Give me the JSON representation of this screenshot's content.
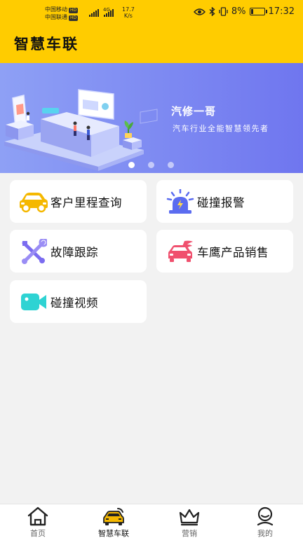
{
  "status_bar": {
    "carrier1": "中国移动",
    "carrier2": "中国联通",
    "hd": "HD",
    "net_type": "4G",
    "speed_value": "17.7",
    "speed_unit": "K/s",
    "battery": "8%",
    "time": "17:32"
  },
  "header": {
    "title": "智慧车联"
  },
  "banner": {
    "title": "汽修一哥",
    "subtitle": "汽车行业全能智慧领先者",
    "slide_count": 3,
    "active_slide": 0
  },
  "menu": [
    {
      "label": "客户里程查询",
      "icon": "car-icon",
      "color": "#f5b800"
    },
    {
      "label": "碰撞报警",
      "icon": "alarm-light-icon",
      "color": "#5b6cf0"
    },
    {
      "label": "故障跟踪",
      "icon": "tools-icon",
      "color": "#7b6cf0"
    },
    {
      "label": "车鹰产品销售",
      "icon": "winged-car-icon",
      "color": "#f0506e"
    },
    {
      "label": "碰撞视频",
      "icon": "video-camera-icon",
      "color": "#2ed3d3"
    }
  ],
  "nav": {
    "items": [
      {
        "label": "首页",
        "icon": "home-icon"
      },
      {
        "label": "智慧车联",
        "icon": "car-signal-icon"
      },
      {
        "label": "营销",
        "icon": "crown-icon"
      },
      {
        "label": "我的",
        "icon": "user-icon"
      }
    ],
    "active_index": 1
  }
}
